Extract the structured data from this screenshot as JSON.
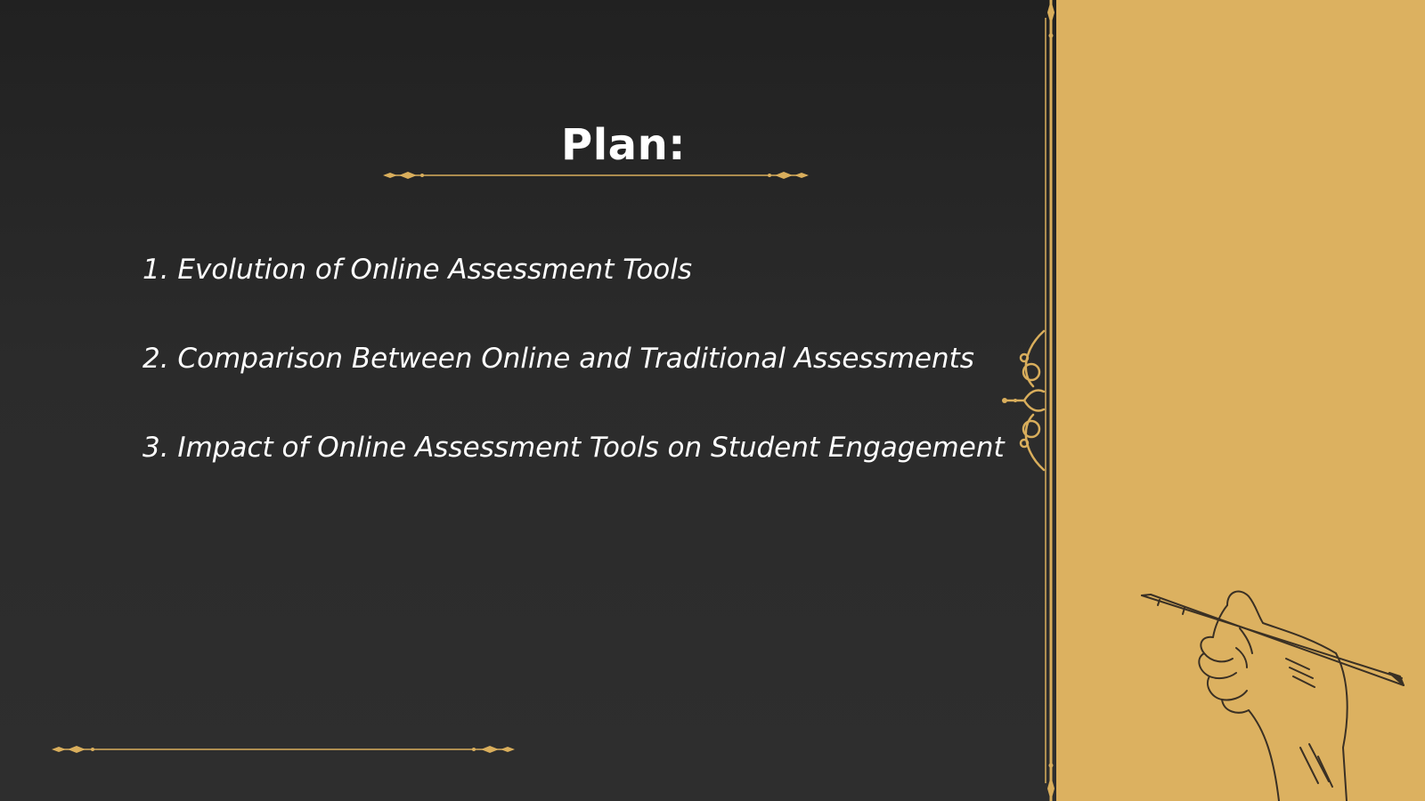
{
  "slide": {
    "title": "Plan:",
    "items": [
      "1. Evolution of Online Assessment Tools",
      "2. Comparison Between Online and Traditional Assessments",
      "3. Impact of Online Assessment Tools on Student Engagement"
    ]
  },
  "theme": {
    "background": "#2a2a2a",
    "panel": "#dcb160",
    "accent": "#d9ae5c",
    "text": "#ffffff"
  },
  "icons": {
    "title_divider": "ornamental-divider-icon",
    "bottom_divider": "ornamental-divider-icon",
    "side_flourish": "scroll-flourish-icon",
    "illustration": "hand-writing-pencil-icon"
  }
}
